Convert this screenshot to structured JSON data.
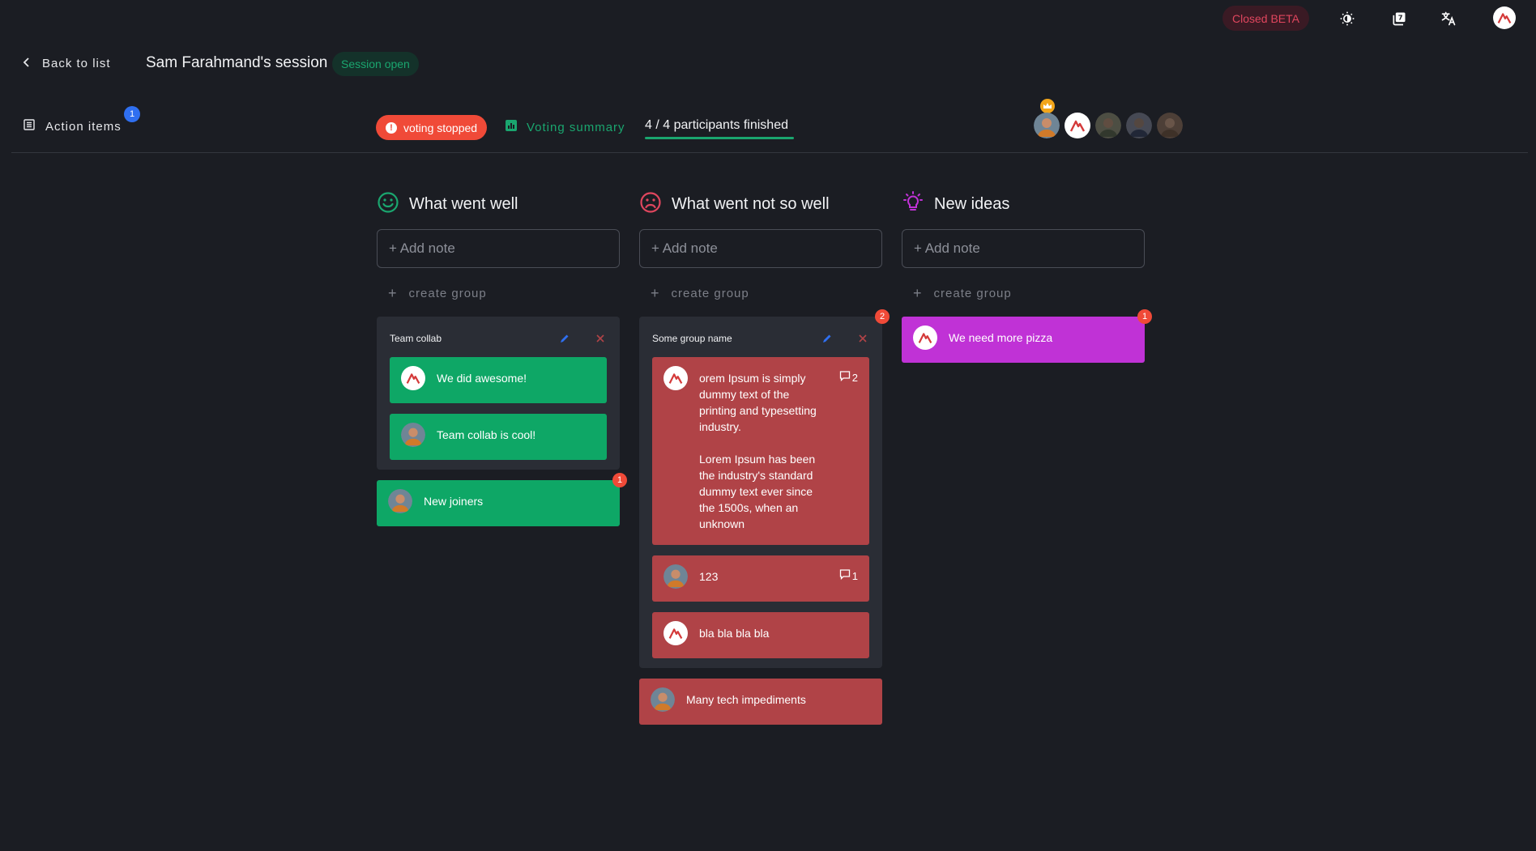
{
  "topbar": {
    "beta_label": "Closed BETA",
    "icons": [
      "theme-toggle-icon",
      "release-notes-icon",
      "translate-icon"
    ]
  },
  "header": {
    "back_label": "Back to list",
    "session_title": "Sam Farahmand's session",
    "session_status": "Session open"
  },
  "toolbar": {
    "action_items_label": "Action items",
    "action_items_count": "1",
    "voting_status": "voting stopped",
    "voting_summary_label": "Voting summary",
    "participants_label": "4 / 4 participants finished"
  },
  "columns": [
    {
      "title": "What went well",
      "icon": "smile-icon",
      "color": "#1aa66f",
      "add_note_placeholder": "+ Add note",
      "create_group_label": "create group",
      "groups": [
        {
          "name": "Team collab",
          "cards": [
            {
              "text": "We did awesome!",
              "avatar": "logo"
            },
            {
              "text": "Team collab is cool!",
              "avatar": "photo"
            }
          ]
        }
      ],
      "cards": [
        {
          "text": "New joiners",
          "avatar": "photo",
          "votes": "1"
        }
      ]
    },
    {
      "title": "What went not so well",
      "icon": "frown-icon",
      "color": "#e0465e",
      "add_note_placeholder": "+ Add note",
      "create_group_label": "create group",
      "groups": [
        {
          "name": "Some group name",
          "votes": "2",
          "cards": [
            {
              "text": "orem Ipsum is simply dummy text of the printing and typesetting industry.\n\nLorem Ipsum has been the industry's standard dummy text ever since the 1500s, when an unknown",
              "avatar": "logo",
              "comments": "2"
            },
            {
              "text": "123",
              "avatar": "photo",
              "comments": "1"
            },
            {
              "text": "bla bla bla bla",
              "avatar": "logo"
            }
          ]
        }
      ],
      "cards": [
        {
          "text": "Many tech impediments",
          "avatar": "photo"
        }
      ]
    },
    {
      "title": "New ideas",
      "icon": "lightbulb-icon",
      "color": "#c032d6",
      "add_note_placeholder": "+ Add note",
      "create_group_label": "create group",
      "groups": [],
      "cards": [
        {
          "text": "We need more pizza",
          "avatar": "logo",
          "votes": "1"
        }
      ]
    }
  ]
}
